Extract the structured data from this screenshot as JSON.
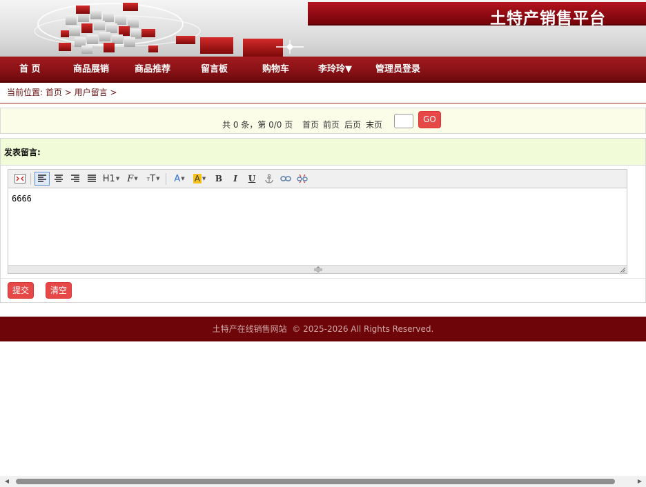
{
  "header": {
    "site_title": "土特产销售平台"
  },
  "nav": {
    "items": [
      {
        "label": "首 页"
      },
      {
        "label": "商品展销"
      },
      {
        "label": "商品推荐"
      },
      {
        "label": "留言板"
      },
      {
        "label": "购物车"
      },
      {
        "label": "李玲玲▼"
      },
      {
        "label": "管理员登录"
      }
    ]
  },
  "breadcrumb": {
    "prefix": "当前位置:",
    "home": "首页",
    "sep": ">",
    "current": "用户留言",
    "trail": ">"
  },
  "pager": {
    "info": "共 0 条，第 0/0 页",
    "first": "首页",
    "prev": "前页",
    "next": "后页",
    "last": "末页",
    "go_label": "GO",
    "page_value": ""
  },
  "message_form": {
    "heading": "发表留言:",
    "content": "6666",
    "submit_label": "提交",
    "clear_label": "清空"
  },
  "toolbar": {
    "heading_label": "H1",
    "font_label": "F",
    "size_label": "T",
    "color_label": "A",
    "bg_color_label": "A",
    "bold_label": "B",
    "italic_label": "I",
    "underline_label": "U"
  },
  "footer": {
    "text": "土特产在线销售网站  © 2025-2026 All Rights Reserved."
  },
  "colors": {
    "brand_red": "#8a1216",
    "button_red": "#e64848",
    "footer_bg": "#6e0508"
  }
}
